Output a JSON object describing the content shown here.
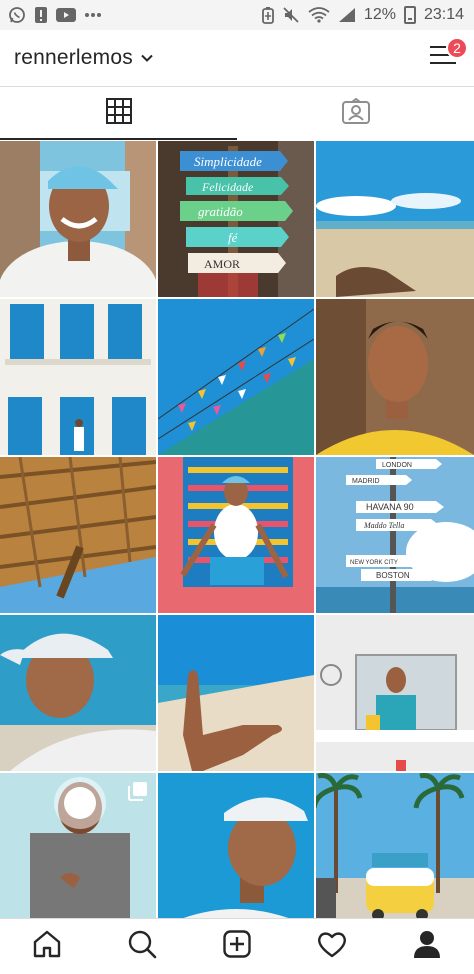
{
  "status_bar": {
    "left_icons": [
      "whatsapp-icon",
      "alert-icon",
      "youtube-icon",
      "more-dots-icon"
    ],
    "right_icons": [
      "battery-saver-icon",
      "mute-icon",
      "wifi-icon",
      "signal-icon",
      "battery-icon"
    ],
    "battery_percent": "12%",
    "time": "23:14"
  },
  "header": {
    "username": "rennerlemos",
    "notification_count": "2"
  },
  "tabs": [
    {
      "name": "grid-view",
      "icon": "grid-icon",
      "active": true
    },
    {
      "name": "tagged-view",
      "icon": "tagged-person-icon",
      "active": false
    }
  ],
  "grid": {
    "tiles": [
      {
        "subject": "selfie-smiling-blue-cap"
      },
      {
        "subject": "wooden-signpost",
        "signs": [
          "Simplicidade",
          "Felicidade",
          "gratidão",
          "fé",
          "AMOR"
        ]
      },
      {
        "subject": "beach-feet-sky"
      },
      {
        "subject": "blue-windows-building"
      },
      {
        "subject": "colorful-flags-sky"
      },
      {
        "subject": "portrait-yellow-shirt"
      },
      {
        "subject": "thatched-roof"
      },
      {
        "subject": "sitting-colorful-bench"
      },
      {
        "subject": "city-signpost",
        "signs": [
          "LONDON",
          "MADRID",
          "HAVANA 90",
          "Maddo Tella",
          "NEW YORK CITY",
          "BOSTON"
        ]
      },
      {
        "subject": "selfie-white-cap"
      },
      {
        "subject": "hang-loose-beach"
      },
      {
        "subject": "mirror-selfie-bathroom"
      },
      {
        "subject": "flash-selfie",
        "multiple": true
      },
      {
        "subject": "selfie-white-cap-sky"
      },
      {
        "subject": "palm-trees-van"
      }
    ]
  },
  "bottom_nav": [
    {
      "name": "home",
      "icon": "home-icon"
    },
    {
      "name": "search",
      "icon": "search-icon"
    },
    {
      "name": "new-post",
      "icon": "add-post-icon"
    },
    {
      "name": "activity",
      "icon": "heart-icon"
    },
    {
      "name": "profile",
      "icon": "profile-icon"
    }
  ],
  "colors": {
    "badge": "#ed4956",
    "text": "#262626",
    "divider": "#dbdbdb"
  }
}
